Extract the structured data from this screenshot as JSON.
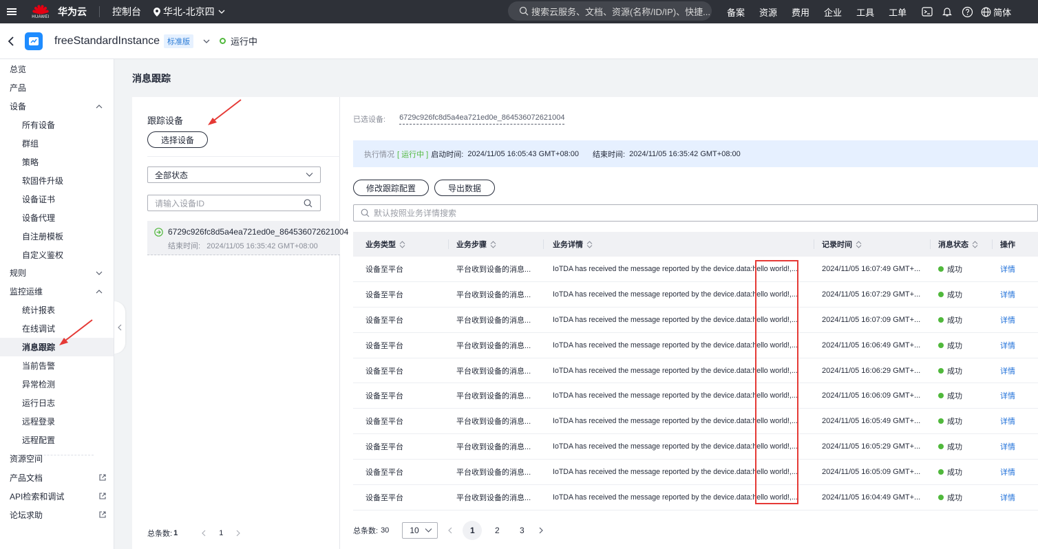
{
  "topbar": {
    "brand": "华为云",
    "logo_text": "HUAWEI",
    "console": "控制台",
    "region": "华北-北京四",
    "search_placeholder": "搜索云服务、文档、资源(名称/ID/IP)、快捷...",
    "links": [
      "备案",
      "资源",
      "费用",
      "企业",
      "工具",
      "工单"
    ],
    "language": "简体"
  },
  "instance": {
    "name": "freeStandardInstance",
    "edition": "标准版",
    "status": "运行中"
  },
  "sidebar": {
    "items": [
      {
        "label": "总览",
        "level": 1
      },
      {
        "label": "产品",
        "level": 1
      },
      {
        "label": "设备",
        "level": 1,
        "expand": "up"
      },
      {
        "label": "所有设备",
        "level": 2
      },
      {
        "label": "群组",
        "level": 2
      },
      {
        "label": "策略",
        "level": 2
      },
      {
        "label": "软固件升级",
        "level": 2
      },
      {
        "label": "设备证书",
        "level": 2
      },
      {
        "label": "设备代理",
        "level": 2
      },
      {
        "label": "自注册模板",
        "level": 2
      },
      {
        "label": "自定义鉴权",
        "level": 2
      },
      {
        "label": "规则",
        "level": 1,
        "expand": "down"
      },
      {
        "label": "监控运维",
        "level": 1,
        "expand": "up"
      },
      {
        "label": "统计报表",
        "level": 2
      },
      {
        "label": "在线调试",
        "level": 2
      },
      {
        "label": "消息跟踪",
        "level": 2,
        "active": true
      },
      {
        "label": "当前告警",
        "level": 2
      },
      {
        "label": "异常检测",
        "level": 2
      },
      {
        "label": "运行日志",
        "level": 2
      },
      {
        "label": "远程登录",
        "level": 2
      },
      {
        "label": "远程配置",
        "level": 2
      },
      {
        "label": "资源空间",
        "level": 1
      },
      {
        "label": "产品文档",
        "level": 1,
        "external": true
      },
      {
        "label": "API检索和调试",
        "level": 1,
        "external": true
      },
      {
        "label": "论坛求助",
        "level": 1,
        "external": true
      }
    ]
  },
  "page": {
    "title": "消息跟踪"
  },
  "left_panel": {
    "title": "跟踪设备",
    "select_button": "选择设备",
    "status_filter": "全部状态",
    "device_search_placeholder": "请输入设备ID",
    "device": {
      "id": "6729c926fc8d5a4ea721ed0e_864536072621004",
      "end_label": "结束时间:",
      "end_time": "2024/11/05 16:35:42 GMT+08:00"
    },
    "total_label": "总条数:",
    "total": "1",
    "page": "1"
  },
  "right_panel": {
    "selected_label": "已选设备:",
    "selected_device": "6729c926fc8d5a4ea721ed0e_864536072621004",
    "exec": {
      "label": "执行情况",
      "status": "[ 运行中 ]",
      "start_label": "启动时间:",
      "start_time": "2024/11/05 16:05:43 GMT+08:00",
      "end_label": "结束时间:",
      "end_time": "2024/11/05 16:35:42 GMT+08:00"
    },
    "modify_button": "修改跟踪配置",
    "export_button": "导出数据",
    "search_placeholder": "默认按照业务详情搜索",
    "columns": [
      "业务类型",
      "业务步骤",
      "业务详情",
      "记录时间",
      "消息状态",
      "操作"
    ],
    "rows": [
      {
        "type": "设备至平台",
        "step": "平台收到设备的消息...",
        "detail": "IoTDA has received the message reported by the device.data:hello world!,...",
        "time": "2024/11/05 16:07:49 GMT+...",
        "status": "成功",
        "action": "详情"
      },
      {
        "type": "设备至平台",
        "step": "平台收到设备的消息...",
        "detail": "IoTDA has received the message reported by the device.data:hello world!,...",
        "time": "2024/11/05 16:07:29 GMT+...",
        "status": "成功",
        "action": "详情"
      },
      {
        "type": "设备至平台",
        "step": "平台收到设备的消息...",
        "detail": "IoTDA has received the message reported by the device.data:hello world!,...",
        "time": "2024/11/05 16:07:09 GMT+...",
        "status": "成功",
        "action": "详情"
      },
      {
        "type": "设备至平台",
        "step": "平台收到设备的消息...",
        "detail": "IoTDA has received the message reported by the device.data:hello world!,...",
        "time": "2024/11/05 16:06:49 GMT+...",
        "status": "成功",
        "action": "详情"
      },
      {
        "type": "设备至平台",
        "step": "平台收到设备的消息...",
        "detail": "IoTDA has received the message reported by the device.data:hello world!,...",
        "time": "2024/11/05 16:06:29 GMT+...",
        "status": "成功",
        "action": "详情"
      },
      {
        "type": "设备至平台",
        "step": "平台收到设备的消息...",
        "detail": "IoTDA has received the message reported by the device.data:hello world!,...",
        "time": "2024/11/05 16:06:09 GMT+...",
        "status": "成功",
        "action": "详情"
      },
      {
        "type": "设备至平台",
        "step": "平台收到设备的消息...",
        "detail": "IoTDA has received the message reported by the device.data:hello world!,...",
        "time": "2024/11/05 16:05:49 GMT+...",
        "status": "成功",
        "action": "详情"
      },
      {
        "type": "设备至平台",
        "step": "平台收到设备的消息...",
        "detail": "IoTDA has received the message reported by the device.data:hello world!,...",
        "time": "2024/11/05 16:05:29 GMT+...",
        "status": "成功",
        "action": "详情"
      },
      {
        "type": "设备至平台",
        "step": "平台收到设备的消息...",
        "detail": "IoTDA has received the message reported by the device.data:hello world!,...",
        "time": "2024/11/05 16:05:09 GMT+...",
        "status": "成功",
        "action": "详情"
      },
      {
        "type": "设备至平台",
        "step": "平台收到设备的消息...",
        "detail": "IoTDA has received the message reported by the device.data:hello world!,...",
        "time": "2024/11/05 16:04:49 GMT+...",
        "status": "成功",
        "action": "详情"
      }
    ],
    "total_label": "总条数:",
    "total": "30",
    "page_size": "10",
    "pages": [
      "1",
      "2",
      "3"
    ],
    "current_page": "1"
  },
  "colors": {
    "topbar": "#2e3138",
    "success": "#50b83c",
    "link": "#1e6fd9",
    "annotation": "#e53935"
  }
}
